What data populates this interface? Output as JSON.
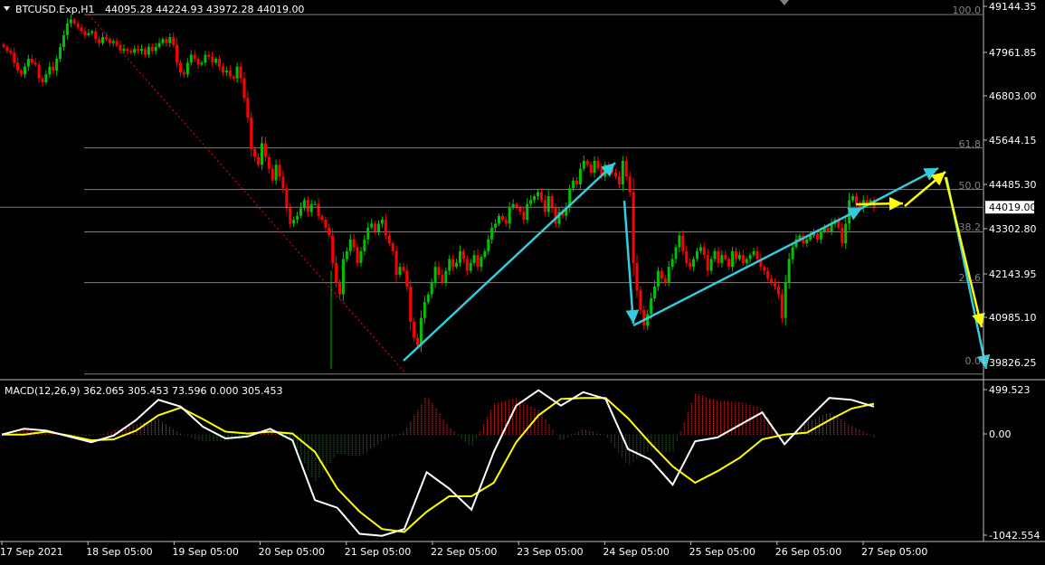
{
  "header": {
    "symbol": "BTCUSD.Exp,H1",
    "ohlc": "44095.28 44224.93 43972.28 44019.00"
  },
  "indicator": {
    "label": "MACD(12,26,9) 362.065 305.453 73.596 0.000 305.453"
  },
  "colors": {
    "background": "#000000",
    "bull": "#00c000",
    "bear": "#ff0000",
    "macd_line": "#ffffff",
    "signal_line": "#ffff00",
    "histogram_pos": "#ff4040",
    "histogram_neg": "#00a000",
    "arrow_cyan": "#33ccdd",
    "arrow_yellow": "#ffff00",
    "fib_line": "#808080",
    "trend_dotted": "#ff0000"
  },
  "chart_data": [
    {
      "type": "candlestick",
      "price_axis_labels": [
        "49144.35",
        "47961.85",
        "46803.00",
        "45644.15",
        "44485.30",
        "43302.80",
        "42143.95",
        "40985.10",
        "39826.25"
      ],
      "current_price_label": "44019.00",
      "ylim": [
        39650,
        49250
      ],
      "time_labels": [
        "17 Sep 2021",
        "18 Sep 05:00",
        "19 Sep 05:00",
        "20 Sep 05:00",
        "21 Sep 05:00",
        "22 Sep 05:00",
        "23 Sep 05:00",
        "24 Sep 05:00",
        "25 Sep 05:00",
        "26 Sep 05:00",
        "27 Sep 05:00"
      ],
      "fibonacci": {
        "levels": [
          {
            "label": "100.0",
            "price": 48925
          },
          {
            "label": "61.8",
            "price": 45530
          },
          {
            "label": "50.0",
            "price": 44470
          },
          {
            "label": "38.2",
            "price": 43390
          },
          {
            "label": "23.6",
            "price": 42100
          },
          {
            "label": "0.0",
            "price": 39770
          }
        ]
      },
      "close_series": [
        48100,
        48000,
        47950,
        47700,
        47500,
        47400,
        47600,
        47800,
        47700,
        47650,
        47300,
        47200,
        47400,
        47600,
        47500,
        47800,
        48100,
        48400,
        48700,
        48800,
        48700,
        48600,
        48500,
        48400,
        48450,
        48500,
        48300,
        48200,
        48350,
        48300,
        48200,
        48250,
        48150,
        48000,
        48050,
        48000,
        47950,
        48050,
        48000,
        48050,
        47900,
        48100,
        48000,
        48100,
        48200,
        48300,
        48200,
        48350,
        48150,
        47700,
        47450,
        47400,
        47700,
        47900,
        47800,
        47650,
        47700,
        47900,
        47850,
        47700,
        47800,
        47600,
        47450,
        47500,
        47350,
        47300,
        47600,
        47300,
        46800,
        46300,
        45500,
        45300,
        45100,
        45650,
        45300,
        45000,
        44700,
        45100,
        44800,
        44500,
        44000,
        43600,
        43700,
        43800,
        44000,
        44200,
        43900,
        44100,
        44100,
        43800,
        43700,
        43500,
        43300,
        42600,
        42100,
        41800,
        42700,
        42900,
        43200,
        43000,
        42600,
        42900,
        43200,
        43500,
        43600,
        43400,
        43600,
        43700,
        43300,
        43100,
        42900,
        42300,
        42500,
        42400,
        42000,
        41100,
        40700,
        40500,
        41200,
        41600,
        41800,
        42100,
        42500,
        42300,
        42100,
        42400,
        42700,
        42500,
        42600,
        42900,
        42700,
        42400,
        42600,
        42800,
        42500,
        42750,
        42900,
        43200,
        43500,
        43600,
        43800,
        43700,
        43600,
        44000,
        44100,
        44000,
        43900,
        43700,
        44100,
        44200,
        44300,
        44400,
        44200,
        43900,
        44300,
        44000,
        43600,
        43900,
        43800,
        44000,
        44500,
        44700,
        44600,
        45000,
        45200,
        45100,
        44900,
        45200,
        45000,
        44800,
        45100,
        45000,
        44900,
        44800,
        44600,
        45200,
        44800,
        44400,
        42600,
        41900,
        41400,
        41000,
        41300,
        41700,
        42000,
        42400,
        42200,
        42100,
        42500,
        42700,
        43000,
        43300,
        42900,
        42600,
        42500,
        42700,
        42900,
        43000,
        42800,
        42400,
        42700,
        42900,
        42600,
        42800,
        42700,
        42500,
        42900,
        42700,
        42800,
        42600,
        42700,
        42800,
        42900,
        42700,
        42500,
        42400,
        42200,
        42100,
        42000,
        41800,
        41200,
        42100,
        42700,
        43000,
        43200,
        43300,
        43100,
        43200,
        43300,
        43350,
        43200,
        43400,
        43500,
        43400,
        43600,
        43700,
        43500,
        43100,
        43600,
        44200,
        44300,
        44100,
        44000,
        44200,
        44100,
        44200,
        44000
      ],
      "analysis_arrows": [
        {
          "color": "cyan",
          "from": [
            "21 Sep 05:00",
            39830
          ],
          "to": [
            "23 Sep 05:00",
            45050
          ]
        },
        {
          "color": "cyan",
          "from": [
            "24 Sep 05:00",
            43800
          ],
          "to": [
            "24 Sep 05:00",
            40950
          ]
        },
        {
          "color": "cyan",
          "from": [
            "24 Sep 05:00",
            40950
          ],
          "to": [
            "26 Sep 05:00",
            43700
          ]
        },
        {
          "color": "cyan",
          "from": [
            "26 Sep 05:00",
            43700
          ],
          "to": [
            "27 Sep 05:00",
            45100
          ]
        },
        {
          "color": "cyan",
          "from": [
            "27 Sep 05:00",
            44900
          ],
          "to": [
            "27 Sep 05:00",
            39800
          ]
        },
        {
          "color": "yellow",
          "from": [
            "26 Sep 05:00",
            44000
          ],
          "to": [
            "27 Sep 05:00",
            44100
          ]
        },
        {
          "color": "yellow",
          "from": [
            "27 Sep 05:00",
            44100
          ],
          "to": [
            "27 Sep 05:00",
            44450
          ]
        },
        {
          "color": "yellow",
          "from": [
            "27 Sep 05:00",
            44700
          ],
          "to": [
            "27 Sep 05:00",
            41050
          ]
        }
      ]
    },
    {
      "type": "macd",
      "axis_labels": [
        "499.523",
        "0.00",
        "-1042.554"
      ],
      "ylim": [
        -1100,
        560
      ],
      "macd": [
        0,
        60,
        40,
        -20,
        -80,
        -10,
        150,
        360,
        290,
        80,
        -40,
        -20,
        60,
        -60,
        -680,
        -760,
        -1030,
        -1050,
        -980,
        -390,
        -560,
        -780,
        -180,
        300,
        460,
        300,
        440,
        370,
        -150,
        -260,
        -520,
        -70,
        -30,
        100,
        230,
        -100,
        150,
        380,
        360,
        290
      ],
      "signal": [
        0,
        0,
        30,
        -10,
        -60,
        -50,
        40,
        200,
        280,
        160,
        30,
        10,
        30,
        10,
        -180,
        -560,
        -800,
        -980,
        -1010,
        -800,
        -640,
        -640,
        -500,
        -80,
        200,
        370,
        380,
        380,
        170,
        -90,
        -330,
        -500,
        -380,
        -240,
        -50,
        0,
        20,
        150,
        270,
        320
      ],
      "histogram": [
        0,
        60,
        10,
        -10,
        -20,
        40,
        110,
        160,
        10,
        -80,
        -70,
        -30,
        30,
        -70,
        -500,
        -200,
        -230,
        -70,
        30,
        410,
        80,
        -140,
        320,
        380,
        260,
        -70,
        60,
        -10,
        -320,
        -170,
        -190,
        430,
        350,
        340,
        280,
        -100,
        130,
        230,
        90,
        -30
      ]
    }
  ]
}
